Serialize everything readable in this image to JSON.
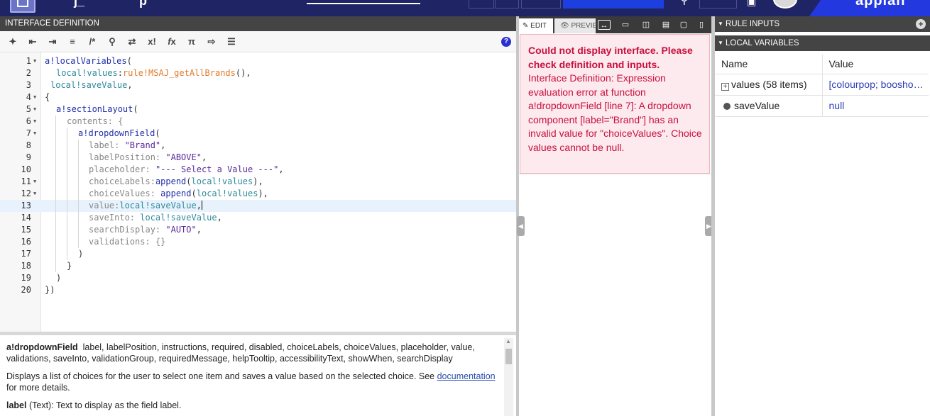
{
  "left_panel": {
    "title": "INTERFACE DEFINITION"
  },
  "code_lines": [
    {
      "num": "1",
      "fold": true
    },
    {
      "num": "2",
      "fold": false
    },
    {
      "num": "3",
      "fold": false
    },
    {
      "num": "4",
      "fold": true
    },
    {
      "num": "5",
      "fold": true
    },
    {
      "num": "6",
      "fold": true
    },
    {
      "num": "7",
      "fold": true
    },
    {
      "num": "8",
      "fold": false
    },
    {
      "num": "9",
      "fold": false
    },
    {
      "num": "10",
      "fold": false
    },
    {
      "num": "11",
      "fold": true
    },
    {
      "num": "12",
      "fold": true
    },
    {
      "num": "13",
      "fold": false
    },
    {
      "num": "14",
      "fold": false
    },
    {
      "num": "15",
      "fold": false
    },
    {
      "num": "16",
      "fold": false
    },
    {
      "num": "17",
      "fold": false
    },
    {
      "num": "18",
      "fold": false
    },
    {
      "num": "19",
      "fold": false
    },
    {
      "num": "20",
      "fold": false
    }
  ],
  "code": {
    "l1": [
      "a!localVariables",
      "("
    ],
    "l2": [
      "local!values",
      ":",
      "rule!MSAJ_getAllBrands",
      "(),"
    ],
    "l3": [
      "local!saveValue",
      ","
    ],
    "l4": [
      "{"
    ],
    "l5": [
      "a!sectionLayout",
      "("
    ],
    "l6": [
      "contents",
      ": {"
    ],
    "l7": [
      "a!dropdownField",
      "("
    ],
    "l8": [
      "label",
      ": ",
      "\"Brand\"",
      ","
    ],
    "l9": [
      "labelPosition",
      ": ",
      "\"ABOVE\"",
      ","
    ],
    "l10": [
      "placeholder",
      ": ",
      "\"--- Select a Value ---\"",
      ","
    ],
    "l11": [
      "choiceLabels",
      ":",
      "append",
      "(",
      "local!values",
      "),"
    ],
    "l12": [
      "choiceValues",
      ": ",
      "append",
      "(",
      "local!values",
      "),"
    ],
    "l13": [
      "value",
      ":",
      "local!saveValue",
      ","
    ],
    "l14": [
      "saveInto",
      ": ",
      "local!saveValue",
      ","
    ],
    "l15": [
      "searchDisplay",
      ": ",
      "\"AUTO\"",
      ","
    ],
    "l16": [
      "validations",
      ": {}"
    ],
    "l17": [
      ")"
    ],
    "l18": [
      "}"
    ],
    "l19": [
      ")"
    ],
    "l20": [
      "})"
    ]
  },
  "docs": {
    "function_name": "a!dropdownField",
    "params": "label, labelPosition, instructions, required, disabled, choiceLabels, choiceValues, placeholder, value, validations, saveInto, validationGroup, requiredMessage, helpTooltip, accessibilityText, showWhen, searchDisplay",
    "desc_before": "Displays a list of choices for the user to select one item and saves a value based on the selected choice. See ",
    "desc_link": "documentation",
    "desc_after": " for more details.",
    "more_bold": "label",
    "more_text": " (Text): Text to display as the field label."
  },
  "preview": {
    "tab_edit": "EDIT",
    "tab_preview": "PREVIEW",
    "error_heading": "Could not display interface. Please check definition and inputs.",
    "error_body": "Interface Definition: Expression evaluation error at function a!dropdownField [line 7]: A dropdown component [label=\"Brand\"] has an invalid value for \"choiceValues\". Choice values cannot be null."
  },
  "right_panel": {
    "rule_inputs_title": "RULE INPUTS",
    "local_vars_title": "LOCAL VARIABLES",
    "col_name": "Name",
    "col_value": "Value",
    "rows": [
      {
        "name": "values (58 items)",
        "value": "[colourpop; booshoo; rimmel]"
      },
      {
        "name": "saveValue",
        "value": "null"
      }
    ]
  },
  "colors": {
    "top_bar": "#1f2464",
    "error_text": "#c8103e",
    "error_bg": "#fdeaee",
    "link_blue": "#2c3eb5"
  }
}
